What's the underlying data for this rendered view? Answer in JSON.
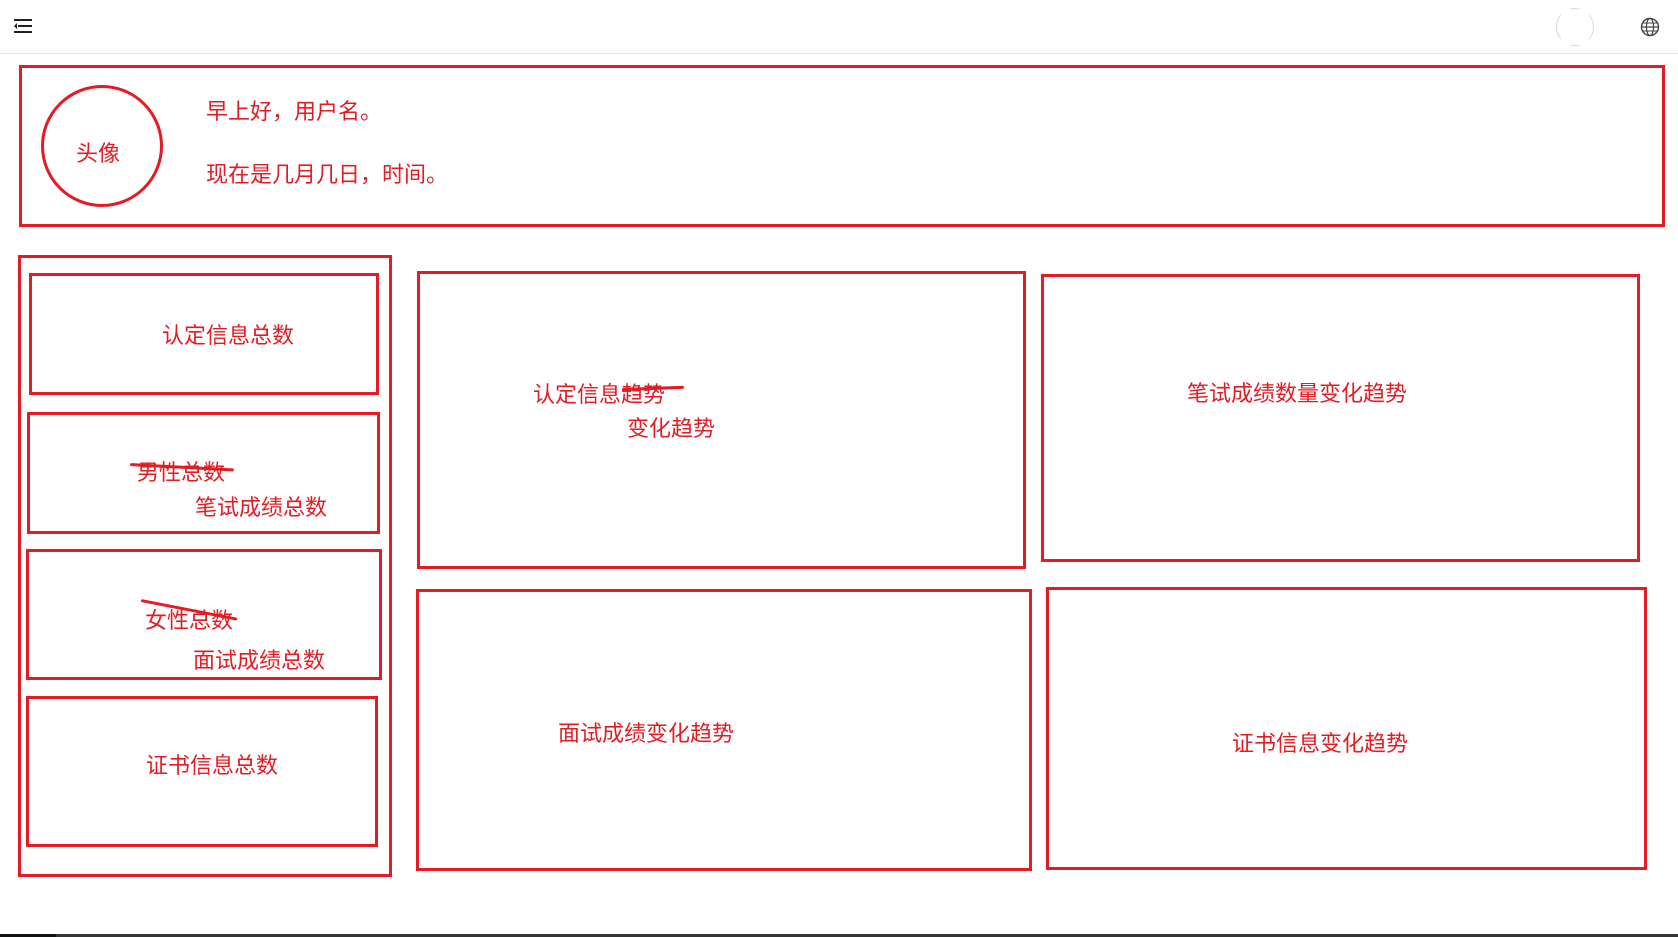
{
  "topbar": {
    "menu_icon": "menu-fold-icon",
    "language_icon": "globe-icon"
  },
  "welcome": {
    "avatar_label": "头像",
    "greeting": "早上好，用户名。",
    "datetime": "现在是几月几日，时间。"
  },
  "stats": {
    "cert_total": "认定信息总数",
    "male_total_struck": "男性总数",
    "written_total": "笔试成绩总数",
    "female_total_struck": "女性总数",
    "interview_total": "面试成绩总数",
    "certificate_total": "证书信息总数"
  },
  "charts": {
    "cert_trend_part1": "认定信息趋势",
    "cert_trend_part2": "变化趋势",
    "written_trend": "笔试成绩数量变化趋势",
    "interview_trend": "面试成绩变化趋势",
    "certificate_trend": "证书信息变化趋势"
  },
  "colors": {
    "annotation": "#e31b23"
  }
}
